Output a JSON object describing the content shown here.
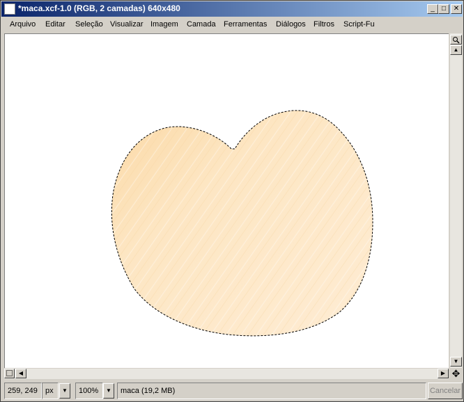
{
  "window": {
    "title": "*maca.xcf-1.0 (RGB, 2 camadas) 640x480",
    "controls": {
      "minimize": "_",
      "maximize": "□",
      "close": "✕"
    }
  },
  "menu": [
    "Arquivo",
    "Editar",
    "Seleção",
    "Visualizar",
    "Imagem",
    "Camada",
    "Ferramentas",
    "Diálogos",
    "Filtros",
    "Script-Fu"
  ],
  "canvas": {
    "shape_fill": "#fde7c4",
    "shape_fill_dark": "#f9d9a8",
    "selection": "marching-ants"
  },
  "status": {
    "coords": "259, 249",
    "unit": "px",
    "zoom": "100%",
    "layer_info": "maca (19,2 MB)",
    "cancel_label": "Cancelar"
  },
  "icons": {
    "nav": "move-cross-icon",
    "zoom_toggle": "magnifier-icon",
    "quick_mask": "quick-mask-icon"
  }
}
